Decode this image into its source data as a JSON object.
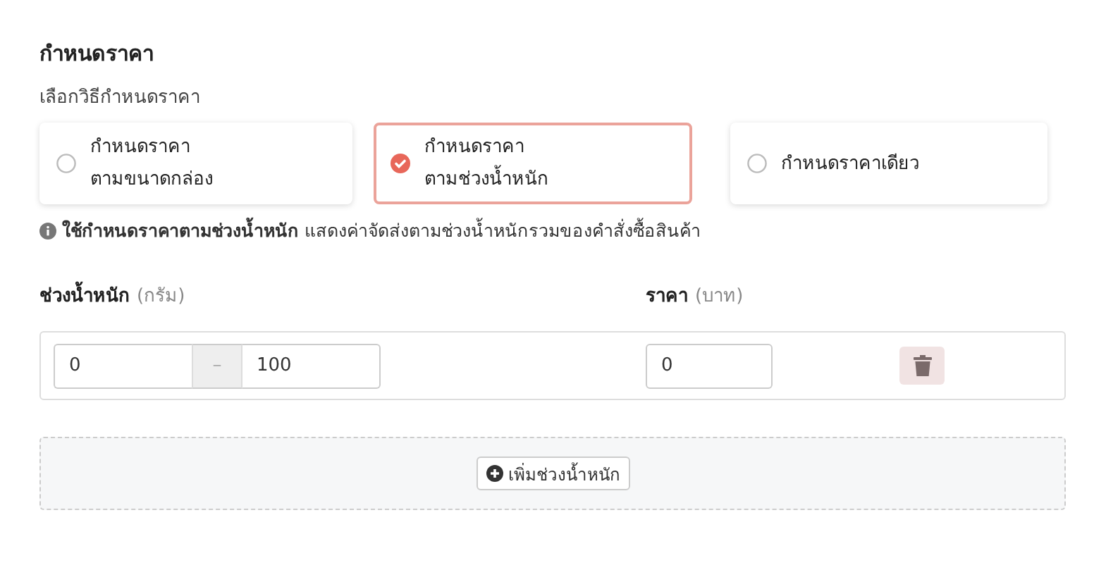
{
  "title": "กำหนดราคา",
  "subtitle": "เลือกวิธีกำหนดราคา",
  "options": [
    {
      "label": "กำหนดราคา\nตามขนาดกล่อง",
      "selected": false
    },
    {
      "label": "กำหนดราคา\nตามช่วงน้ำหนัก",
      "selected": true
    },
    {
      "label": "กำหนดราคาเดียว",
      "selected": false
    }
  ],
  "note": "**ใช้กำหนดราคาตามช่วงน้ำหนัก** แสดงค่าจัดส่งตามช่วงน้ำหนักรวมของคำสั่งซื้อสินค้า",
  "columns": [
    {
      "label": "ช่วงน้ำหนัก",
      "unit": "(กรัม)"
    },
    {
      "label": "ราคา",
      "unit": "(บาท)"
    }
  ],
  "rows": [
    {
      "min": "0",
      "separator": "–",
      "max": "100",
      "price": "0"
    }
  ],
  "add_button": "เพิ่มช่วงน้ำหนัก"
}
